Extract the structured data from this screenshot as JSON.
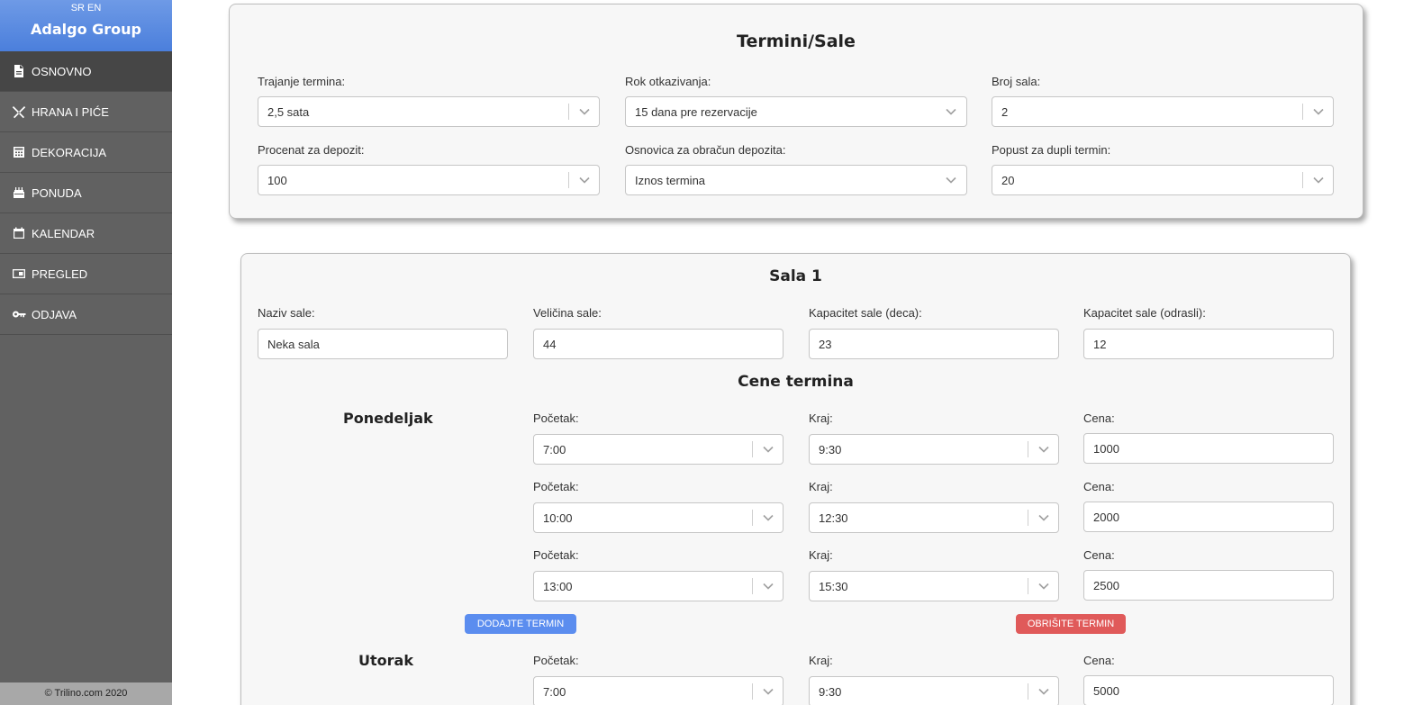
{
  "sidebar": {
    "lang_sr": "SR",
    "lang_en": "EN",
    "brand": "Adalgo Group",
    "items": [
      {
        "label": "OSNOVNO",
        "icon": "document-icon"
      },
      {
        "label": "HRANA I PIĆE",
        "icon": "utensils-icon"
      },
      {
        "label": "DEKORACIJA",
        "icon": "calculator-icon"
      },
      {
        "label": "PONUDA",
        "icon": "cake-icon"
      },
      {
        "label": "KALENDAR",
        "icon": "calendar-icon"
      },
      {
        "label": "PREGLED",
        "icon": "window-icon"
      },
      {
        "label": "ODJAVA",
        "icon": "key-icon"
      }
    ],
    "footer": "© Trilino.com 2020"
  },
  "termini": {
    "title": "Termini/Sale",
    "trajanje_label": "Trajanje termina:",
    "trajanje_value": "2,5 sata",
    "rok_label": "Rok otkazivanja:",
    "rok_value": "15 dana pre rezervacije",
    "broj_label": "Broj sala:",
    "broj_value": "2",
    "procenat_label": "Procenat za depozit:",
    "procenat_value": "100",
    "osnovica_label": "Osnovica za obračun depozita:",
    "osnovica_value": "Iznos termina",
    "popust_label": "Popust za dupli termin:",
    "popust_value": "20"
  },
  "sala": {
    "title": "Sala 1",
    "naziv_label": "Naziv sale:",
    "naziv_value": "Neka sala",
    "velicina_label": "Veličina sale:",
    "velicina_value": "44",
    "kap_deca_label": "Kapacitet sale (deca):",
    "kap_deca_value": "23",
    "kap_odrasli_label": "Kapacitet sale (odrasli):",
    "kap_odrasli_value": "12",
    "cene_title": "Cene termina",
    "pocetak_label": "Početak:",
    "kraj_label": "Kraj:",
    "cena_label": "Cena:",
    "add_button": "DODAJTE TERMIN",
    "delete_button": "OBRIŠITE TERMIN",
    "days": [
      {
        "name": "Ponedeljak",
        "slots": [
          {
            "pocetak": "7:00",
            "kraj": "9:30",
            "cena": "1000"
          },
          {
            "pocetak": "10:00",
            "kraj": "12:30",
            "cena": "2000"
          },
          {
            "pocetak": "13:00",
            "kraj": "15:30",
            "cena": "2500"
          }
        ]
      },
      {
        "name": "Utorak",
        "slots": [
          {
            "pocetak": "7:00",
            "kraj": "9:30",
            "cena": "5000"
          }
        ]
      }
    ]
  }
}
